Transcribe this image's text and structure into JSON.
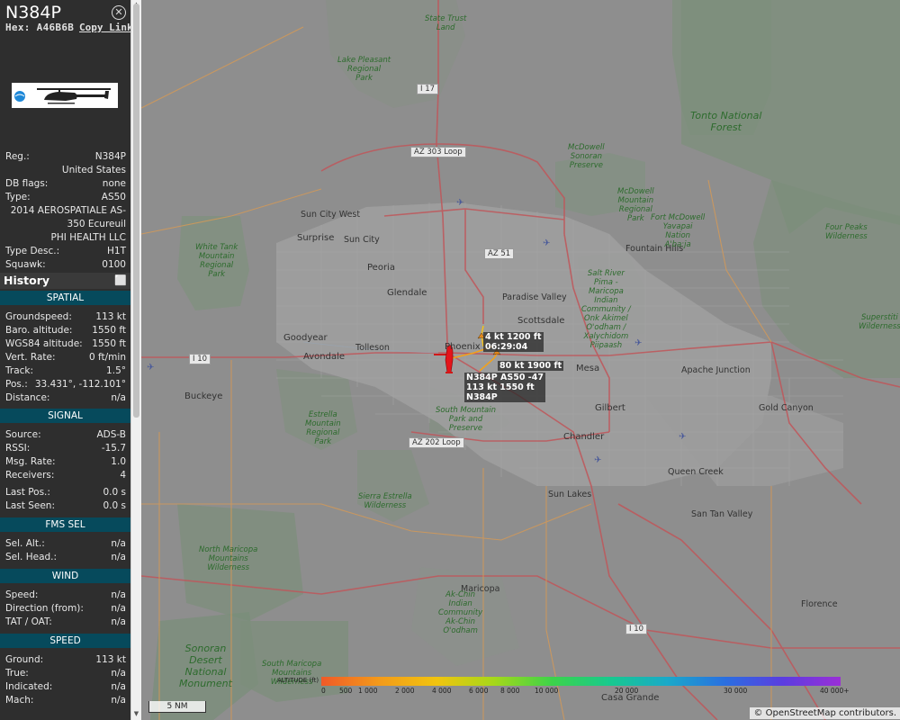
{
  "aircraft": {
    "callsign": "N384P",
    "hex_label": "Hex:",
    "hex": "A46B6B",
    "copy_link": "Copy Link",
    "close_icon": "close-icon"
  },
  "details": [
    {
      "label": "Reg.:",
      "value": "N384P"
    },
    {
      "label": "",
      "value": "United States"
    },
    {
      "label": "DB flags:",
      "value": "none"
    },
    {
      "label": "Type:",
      "value": "AS50"
    },
    {
      "label": "",
      "value": "2014 AEROSPATIALE AS-"
    },
    {
      "label": "",
      "value": "350 Ecureuil"
    },
    {
      "label": "",
      "value": "PHI HEALTH LLC"
    },
    {
      "label": "Type Desc.:",
      "value": "H1T"
    },
    {
      "label": "Squawk:",
      "value": "0100"
    }
  ],
  "history": {
    "title": "History",
    "icon": "expand-icon",
    "icon_glyph": "⬜"
  },
  "spatial": {
    "title": "SPATIAL",
    "rows": [
      {
        "label": "Groundspeed:",
        "value": "113 kt"
      },
      {
        "label": "Baro. altitude:",
        "value": "1550 ft"
      },
      {
        "label": "WGS84 altitude:",
        "value": "1550 ft"
      },
      {
        "label": "Vert. Rate:",
        "value": "0 ft/min"
      },
      {
        "label": "Track:",
        "value": "1.5°"
      },
      {
        "label": "Pos.:",
        "value": "33.431°, -112.101°"
      },
      {
        "label": "Distance:",
        "value": "n/a"
      }
    ]
  },
  "signal": {
    "title": "SIGNAL",
    "rows": [
      {
        "label": "Source:",
        "value": "ADS-B"
      },
      {
        "label": "RSSI:",
        "value": "-15.7"
      },
      {
        "label": "Msg. Rate:",
        "value": "1.0"
      },
      {
        "label": "Receivers:",
        "value": "4"
      },
      {
        "label": "Last Pos.:",
        "value": "0.0 s"
      },
      {
        "label": "Last Seen:",
        "value": "0.0 s"
      }
    ]
  },
  "fms": {
    "title": "FMS SEL",
    "rows": [
      {
        "label": "Sel. Alt.:",
        "value": "n/a"
      },
      {
        "label": "Sel. Head.:",
        "value": "n/a"
      }
    ]
  },
  "wind": {
    "title": "WIND",
    "rows": [
      {
        "label": "Speed:",
        "value": "n/a"
      },
      {
        "label": "Direction (from):",
        "value": "n/a"
      },
      {
        "label": "TAT / OAT:",
        "value": "n/a"
      }
    ]
  },
  "speed": {
    "title": "SPEED",
    "rows": [
      {
        "label": "Ground:",
        "value": "113 kt"
      },
      {
        "label": "True:",
        "value": "n/a"
      },
      {
        "label": "Indicated:",
        "value": "n/a"
      },
      {
        "label": "Mach:",
        "value": "n/a"
      }
    ]
  },
  "map": {
    "labels": {
      "tag1": {
        "line1": "N384P AS50 -47",
        "line2": "113 kt 1550 ft",
        "line3": "N384P"
      },
      "tag2": {
        "line1": "4 kt  1200 ft",
        "line2": "06:29:04"
      },
      "tag3": {
        "line1": "80 kt  1900 ft"
      }
    },
    "places": {
      "phoenix": "Phoenix",
      "mesa": "Mesa",
      "scottsdale": "Scottsdale",
      "glendale": "Glendale",
      "peoria": "Peoria",
      "surprise": "Surprise",
      "goodyear": "Goodyear",
      "avondale": "Avondale",
      "buckeye": "Buckeye",
      "tolleson": "Tolleson",
      "chandler": "Chandler",
      "gilbert": "Gilbert",
      "queen_creek": "Queen Creek",
      "paradise_valley": "Paradise Valley",
      "fountain_hills": "Fountain Hills",
      "sun_city": "Sun City",
      "sun_city_west": "Sun City West",
      "apache_junction": "Apache Junction",
      "gold_canyon": "Gold Canyon",
      "sun_lakes": "Sun Lakes",
      "san_tan_valley": "San Tan Valley",
      "maricopa": "Maricopa",
      "florence": "Florence",
      "casa_grande": "Casa Grande"
    },
    "parks": {
      "state_trust": "State Trust\nLand",
      "lake_pleasant": "Lake Pleasant\nRegional\nPark",
      "tonto": "Tonto National\nForest",
      "mcdowell_sonoran": "McDowell\nSonoran\nPreserve",
      "mcdowell_mountain": "McDowell\nMountain\nRegional\nPark",
      "fort_mcdowell": "Fort McDowell\nYavapai\nNation\nA'ba:ja",
      "four_peaks": "Four Peaks\nWilderness",
      "white_tank": "White Tank\nMountain\nRegional\nPark",
      "salt_river": "Salt River\nPima -\nMaricopa\nIndian\nCommunity /\nOnk Akimel\nO'odham /\nXalychidom\nPiipaash",
      "superstition": "Superstiti\nWilderness",
      "south_mountain": "South Mountain\nPark and\nPreserve",
      "estrella": "Estrella\nMountain\nRegional\nPark",
      "sierra_estrella": "Sierra Estrella\nWilderness",
      "north_maricopa": "North Maricopa\nMountains\nWilderness",
      "ak_chin": "Ak-Chin\nIndian\nCommunity\nAk-Chin\nO'odham",
      "sonoran_desert": "Sonoran\nDesert\nNational\nMonument",
      "south_maricopa": "South Maricopa\nMountains\nWilderness"
    },
    "shields": {
      "i17": "I 17",
      "az303": "AZ 303 Loop",
      "az51": "AZ 51",
      "i10w": "I 10",
      "az202": "AZ 202 Loop",
      "i10s": "I 10"
    },
    "scale": "5 NM",
    "attribution": "© OpenStreetMap contributors."
  },
  "altitude_legend": {
    "label": "ALTITUDE (ft)",
    "ticks": [
      {
        "text": "0",
        "frac": 0.0
      },
      {
        "text": "500",
        "frac": 0.035
      },
      {
        "text": "1 000",
        "frac": 0.071
      },
      {
        "text": "2 000",
        "frac": 0.142
      },
      {
        "text": "4 000",
        "frac": 0.213
      },
      {
        "text": "6 000",
        "frac": 0.285
      },
      {
        "text": "8 000",
        "frac": 0.345
      },
      {
        "text": "10 000",
        "frac": 0.41
      },
      {
        "text": "20 000",
        "frac": 0.565
      },
      {
        "text": "30 000",
        "frac": 0.775
      },
      {
        "text": "40 000+",
        "frac": 0.96
      }
    ],
    "colors": [
      "#f05a28",
      "#f39a1a",
      "#f1c40f",
      "#a5d81a",
      "#3dd34a",
      "#18c98e",
      "#1aa9c9",
      "#2a6fe0",
      "#5b3de0",
      "#9a2fd6"
    ]
  }
}
